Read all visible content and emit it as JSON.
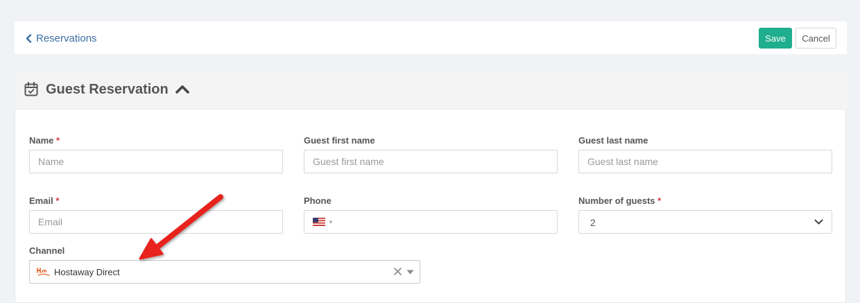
{
  "header": {
    "back_label": "Reservations",
    "save_label": "Save",
    "cancel_label": "Cancel"
  },
  "section": {
    "title": "Guest Reservation"
  },
  "form": {
    "name": {
      "label": "Name",
      "required_mark": "*",
      "placeholder": "Name"
    },
    "first_name": {
      "label": "Guest first name",
      "placeholder": "Guest first name"
    },
    "last_name": {
      "label": "Guest last name",
      "placeholder": "Guest last name"
    },
    "email": {
      "label": "Email",
      "required_mark": "*",
      "placeholder": "Email"
    },
    "phone": {
      "label": "Phone",
      "country_flag": "us-flag-icon"
    },
    "guests": {
      "label": "Number of guests",
      "required_mark": "*",
      "value": "2"
    },
    "channel": {
      "label": "Channel",
      "value": "Hostaway Direct",
      "logo": "hostaway-logo"
    }
  },
  "colors": {
    "save_button": "#1fae8e",
    "link": "#3a6ea5",
    "required": "#d9363e",
    "annotation_arrow": "#e8231d"
  }
}
